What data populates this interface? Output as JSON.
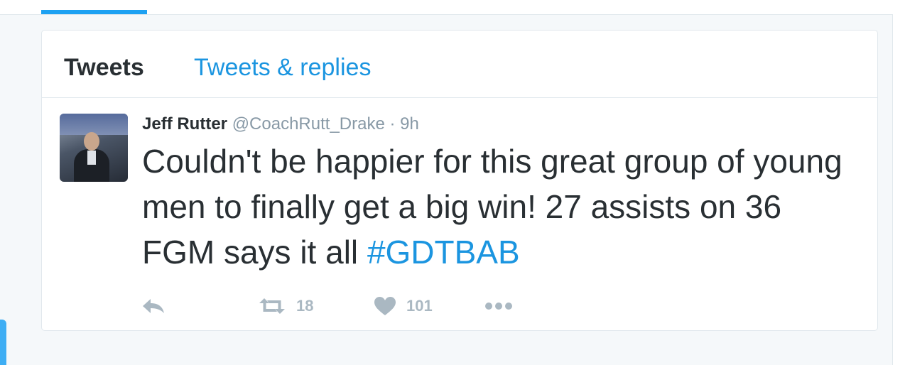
{
  "tabs": [
    {
      "label": "Tweets",
      "active": true
    },
    {
      "label": "Tweets & replies",
      "active": false
    }
  ],
  "tweet": {
    "fullname": "Jeff Rutter",
    "username": "@CoachRutt_Drake",
    "separator": "·",
    "time": "9h",
    "text": "Couldn't be happier for this great group of young men to finally get a big win! 27 assists on 36 FGM says it all ",
    "hashtag": "#GDTBAB",
    "actions": {
      "reply_icon": "reply-icon",
      "retweet_icon": "retweet-icon",
      "retweet_count": "18",
      "like_icon": "heart-icon",
      "like_count": "101",
      "more_icon": "more-dots-icon"
    }
  },
  "colors": {
    "accent": "#1da1f2",
    "link": "#1b95e0",
    "text": "#292f33",
    "muted": "#8899a6",
    "action_gray": "#aab8c2",
    "background": "#f5f8fa"
  }
}
